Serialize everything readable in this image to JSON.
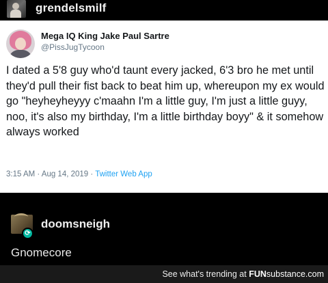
{
  "post": {
    "username": "grendelsmilf"
  },
  "tweet": {
    "display_name": "Mega IQ King Jake Paul Sartre",
    "handle": "@PissJugTycoon",
    "text": "I dated a 5'8 guy who'd taunt every jacked, 6'3 bro he met until they'd pull their fist back to beat him up, whereupon my ex would go \"heyheyheyyy c'maahn I'm a little guy, I'm just a little guyy, noo, it's also my birthday, I'm a little birthday boyy\" & it somehow always worked",
    "time": "3:15 AM · Aug 14, 2019 · ",
    "app": "Twitter Web App"
  },
  "reblog": {
    "username": "doomsneigh",
    "badge_icon": "reblog-icon",
    "text": "Gnomecore"
  },
  "watermark": {
    "prefix": "See what's trending at ",
    "brand_bold": "FUN",
    "brand_rest": "substance.com"
  }
}
